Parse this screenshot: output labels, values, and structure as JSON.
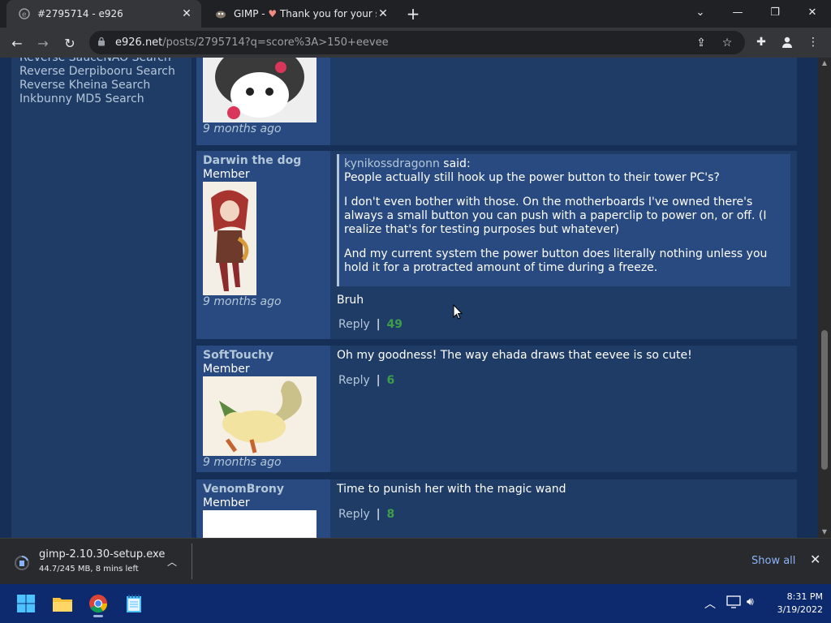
{
  "tabs": [
    {
      "title": "#2795714 - e926"
    },
    {
      "title_prefix": "GIMP - ",
      "title_rest": "Thank you for your su"
    }
  ],
  "address": {
    "host": "e926.net",
    "path": "/posts/2795714?q=score%3A>150+eevee"
  },
  "sidebar": {
    "links": [
      "Reverse SauceNAO Search",
      "Reverse Derpibooru Search",
      "Reverse Kheina Search",
      "Inkbunny MD5 Search"
    ]
  },
  "comments": [
    {
      "time": "9 months ago"
    },
    {
      "author": "Darwin the dog",
      "role": "Member",
      "time": "9 months ago",
      "quote": {
        "author": "kynikossdragonn",
        "said": "said:",
        "paragraphs": [
          "People actually still hook up the power button to their tower PC's?",
          "I don't even bother with those. On the motherboards I've owned there's always a small button you can push with a paperclip to power on, or off. (I realize that's for testing purposes but whatever)",
          "And my current system the power button does literally nothing unless you hold it for a protracted amount of time during a freeze."
        ]
      },
      "text": "Bruh",
      "reply": "Reply",
      "sep": "|",
      "score": "49"
    },
    {
      "author": "SoftTouchy",
      "role": "Member",
      "time": "9 months ago",
      "text": "Oh my goodness! The way ehada draws that eevee is so cute!",
      "reply": "Reply",
      "sep": "|",
      "score": "6"
    },
    {
      "author": "VenomBrony",
      "role": "Member",
      "text": "Time to punish her with the magic wand",
      "reply": "Reply",
      "sep": "|",
      "score": "8"
    }
  ],
  "download": {
    "filename": "gimp-2.10.30-setup.exe",
    "status": "44.7/245 MB, 8 mins left",
    "show_all": "Show all"
  },
  "clock": {
    "time": "8:31 PM",
    "date": "3/19/2022"
  },
  "icons": [
    "e926-favicon",
    "gimp-favicon",
    "close-icon",
    "plus-icon",
    "back-icon",
    "forward-icon",
    "reload-icon",
    "lock-icon",
    "share-icon",
    "star-icon",
    "extensions-icon",
    "profile-icon",
    "menu-icon",
    "file-icon",
    "chevron-up-icon",
    "windows-start-icon",
    "file-explorer-icon",
    "chrome-icon",
    "notepad-icon",
    "wifi-icon",
    "volume-icon"
  ],
  "colors": {
    "page_bg": "#152f56",
    "section_bg": "#1f3c67",
    "author_bg": "#284a81",
    "link": "#b4c7d9",
    "score_positive": "#3e9e49",
    "taskbar": "#0e2a6f"
  }
}
